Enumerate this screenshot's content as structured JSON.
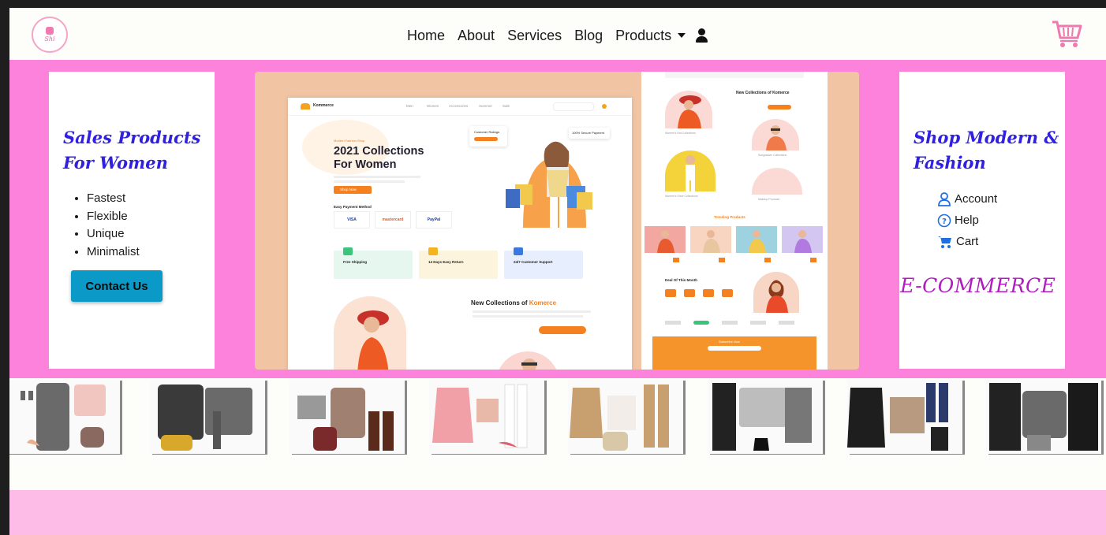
{
  "nav": {
    "logo_text": "Shi",
    "items": [
      "Home",
      "About",
      "Services",
      "Blog"
    ],
    "products_label": "Products",
    "icons": {
      "user": "user-icon",
      "cart": "cart-icon"
    }
  },
  "hero": {
    "left": {
      "title": "Sales Products For Women",
      "features": [
        "Fastest",
        "Flexible",
        "Unique",
        "Minimalist"
      ],
      "contact_button": "Contact Us"
    },
    "right": {
      "title": "Shop Modern & Fashion",
      "links": [
        {
          "label": "Account",
          "icon": "person-icon"
        },
        {
          "label": "Help",
          "icon": "question-circle-icon"
        },
        {
          "label": "Cart",
          "icon": "cart-icon"
        }
      ],
      "brand": "E-COMMERCE"
    },
    "mockup": {
      "brand": "Kommerce",
      "nav": [
        "Men",
        "Women",
        "Accessories",
        "Summer",
        "Sale"
      ],
      "kicker": "Modern Fashion Shop",
      "headline_line1": "2021 Collections",
      "headline_line2": "For Women",
      "shop_button": "Shop Now",
      "payment_label": "Easy Payment Method",
      "payments": [
        "VISA",
        "mastercard",
        "PayPal"
      ],
      "features": [
        "Free Shipping",
        "14 Days Easy Return",
        "24/7 Customer Support"
      ],
      "section_title": "New Collections of",
      "section_brand": "Komerce",
      "badges": [
        "Customer Ratings",
        "100% Secure Payment"
      ],
      "side_section": "New Collections of Komerce",
      "side_labels": [
        "Women's Hat Collections",
        "Sunglasses Collections",
        "Women's Shoe Collections",
        "Makeup Products"
      ],
      "trending": "Trending Products",
      "deal": "Deal Of This Month",
      "newsletter": "Subscribe Now"
    }
  },
  "colors": {
    "hero_bg": "#fd82dc",
    "script_blue": "#3020e0",
    "ecommerce_purple": "#b01cc0",
    "contact_button": "#0b9ac8",
    "footer_band": "#fdbbe8",
    "cart_pink": "#f07ab0"
  },
  "strip": {
    "items": [
      "outfit-1",
      "outfit-2",
      "outfit-3",
      "outfit-4",
      "outfit-5",
      "outfit-6",
      "outfit-7",
      "outfit-8"
    ]
  }
}
